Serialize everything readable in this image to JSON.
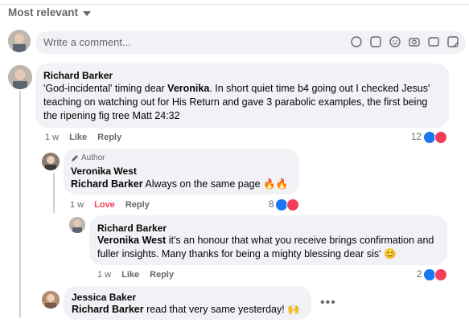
{
  "sort": {
    "label": "Most relevant"
  },
  "composer": {
    "placeholder": "Write a comment..."
  },
  "comments": [
    {
      "author": "Richard Barker",
      "text_pre": "'God-incidental' timing dear ",
      "mention": "Veronika",
      "text_post": ". In short quiet time b4 going out I checked Jesus' teaching on watching out for His Return and gave 3 parabolic examples, the first being the ripening fig tree Matt 24:32",
      "time": "1 w",
      "like": "Like",
      "reply": "Reply",
      "reaction_count": "12"
    },
    {
      "badge": "Author",
      "author": "Veronika West",
      "mention": "Richard Barker",
      "text_post": " Always on the same page 🔥🔥",
      "time": "1 w",
      "like": "Love",
      "reply": "Reply",
      "reaction_count": "8"
    },
    {
      "author": "Richard Barker",
      "mention": "Veronika West",
      "text_post": " it's an honour that what you receive brings confirmation and fuller insights. Many thanks for being a mighty blessing dear sis' 😊",
      "time": "1 w",
      "like": "Like",
      "reply": "Reply",
      "reaction_count": "2"
    },
    {
      "author": "Jessica Baker",
      "mention": "Richard Barker",
      "text_post": " read that very same yesterday! 🙌",
      "more": "•••"
    }
  ],
  "colors": {
    "like": "#1877f2",
    "love": "#f33e58",
    "bubble": "#f0f2f5",
    "muted": "#65676b"
  }
}
